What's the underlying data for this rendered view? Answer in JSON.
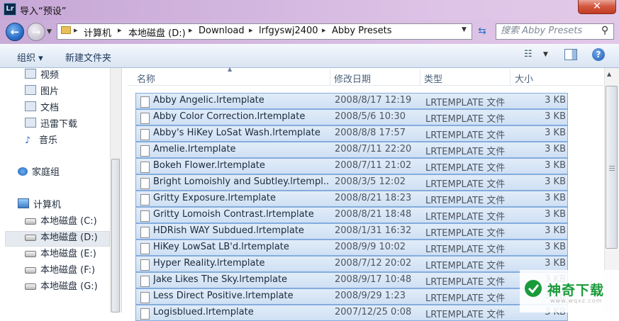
{
  "window": {
    "title": "导入“预设”",
    "app_icon": "Lr",
    "close_glyph": "✕"
  },
  "address": {
    "breadcrumbs": [
      "计算机",
      "本地磁盘 (D:)",
      "Download",
      "lrfgyswj2400",
      "Abby Presets"
    ],
    "search_placeholder": "搜索 Abby Presets"
  },
  "toolbar": {
    "organize_label": "组织 ▾",
    "new_folder_label": "新建文件夹"
  },
  "nav": {
    "libraries": [
      {
        "label": "视频",
        "icon": "video-icon"
      },
      {
        "label": "图片",
        "icon": "picture-icon"
      },
      {
        "label": "文档",
        "icon": "document-icon"
      },
      {
        "label": "迅雷下载",
        "icon": "download-icon"
      },
      {
        "label": "音乐",
        "icon": "music-icon"
      }
    ],
    "homegroup": "家庭组",
    "computer": "计算机",
    "drives": [
      {
        "label": "本地磁盘 (C:)",
        "selected": false
      },
      {
        "label": "本地磁盘 (D:)",
        "selected": true
      },
      {
        "label": "本地磁盘 (E:)",
        "selected": false
      },
      {
        "label": "本地磁盘 (F:)",
        "selected": false
      },
      {
        "label": "本地磁盘 (G:)",
        "selected": false
      }
    ]
  },
  "columns": {
    "name": "名称",
    "date": "修改日期",
    "type": "类型",
    "size": "大小"
  },
  "files": [
    {
      "name": "Abby Angelic.lrtemplate",
      "date": "2008/8/17 12:19",
      "type": "LRTEMPLATE 文件",
      "size": "3 KB"
    },
    {
      "name": "Abby Color Correction.lrtemplate",
      "date": "2008/5/6 10:30",
      "type": "LRTEMPLATE 文件",
      "size": "3 KB"
    },
    {
      "name": "Abby's HiKey LoSat Wash.lrtemplate",
      "date": "2008/8/8 17:57",
      "type": "LRTEMPLATE 文件",
      "size": "3 KB"
    },
    {
      "name": "Amelie.lrtemplate",
      "date": "2008/7/11 22:20",
      "type": "LRTEMPLATE 文件",
      "size": "3 KB"
    },
    {
      "name": "Bokeh Flower.lrtemplate",
      "date": "2008/7/11 21:02",
      "type": "LRTEMPLATE 文件",
      "size": "3 KB"
    },
    {
      "name": "Bright Lomoishly and Subtley.lrtempl...",
      "date": "2008/3/5 12:02",
      "type": "LRTEMPLATE 文件",
      "size": "3 KB"
    },
    {
      "name": "Gritty Exposure.lrtemplate",
      "date": "2008/8/21 18:23",
      "type": "LRTEMPLATE 文件",
      "size": "3 KB"
    },
    {
      "name": "Gritty Lomoish Contrast.lrtemplate",
      "date": "2008/8/21 18:48",
      "type": "LRTEMPLATE 文件",
      "size": "3 KB"
    },
    {
      "name": "HDRish WAY Subdued.lrtemplate",
      "date": "2008/1/31 16:32",
      "type": "LRTEMPLATE 文件",
      "size": "3 KB"
    },
    {
      "name": "HiKey LowSat LB'd.lrtemplate",
      "date": "2008/9/9 10:02",
      "type": "LRTEMPLATE 文件",
      "size": "3 KB"
    },
    {
      "name": "Hyper Reality.lrtemplate",
      "date": "2008/7/12 20:02",
      "type": "LRTEMPLATE 文件",
      "size": "3 KB"
    },
    {
      "name": "Jake Likes The Sky.lrtemplate",
      "date": "2008/9/17 10:48",
      "type": "LRTEMPLATE 文件",
      "size": "3 KB"
    },
    {
      "name": "Less Direct Positive.lrtemplate",
      "date": "2008/9/29 1:23",
      "type": "LRTEMPLATE 文件",
      "size": "3 KB"
    },
    {
      "name": "Logisblued.lrtemplate",
      "date": "2007/12/25 0:08",
      "type": "LRTEMPLATE 文件",
      "size": "3 KB"
    }
  ],
  "watermark": {
    "text": "神奇下载",
    "sub": "www.wqxz.com"
  },
  "colors": {
    "selection": "#cfe0f4",
    "selection_border": "#84acdd",
    "title_bar": "#d3b6df",
    "accent": "#2a6fc9",
    "watermark": "#1a9b3a"
  }
}
